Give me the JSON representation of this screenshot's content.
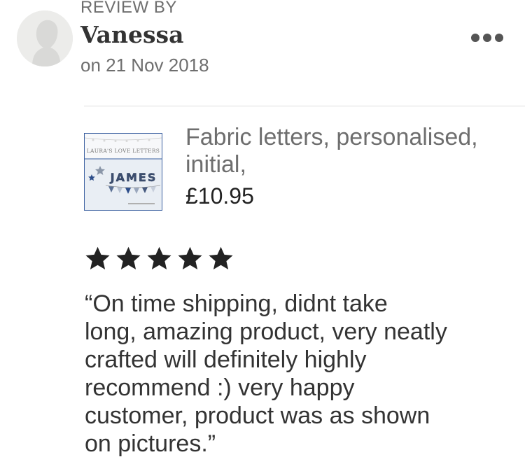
{
  "review": {
    "header_label": "REVIEW BY",
    "reviewer_name": "Vanessa",
    "date": "on 21 Nov 2018",
    "more_icon": "ellipsis-horizontal-icon",
    "rating": 5,
    "rating_max": 5,
    "text": "“On time shipping, didnt take\nlong, amazing product, very neatly\ncrafted will definitely highly\nrecommend  :) very happy\ncustomer, product was as shown\non pictures.”"
  },
  "product": {
    "title": "Fabric letters, personalised, initial,",
    "price": "£10.95",
    "thumbnail": {
      "shop_text": "LAURA'S LOVE LETTERS",
      "name_text": "JAMES"
    }
  },
  "colors": {
    "star": "#222222",
    "thumb_border": "#3a5fa0",
    "divider": "#dddddd",
    "muted_text": "#6e6e6e"
  }
}
